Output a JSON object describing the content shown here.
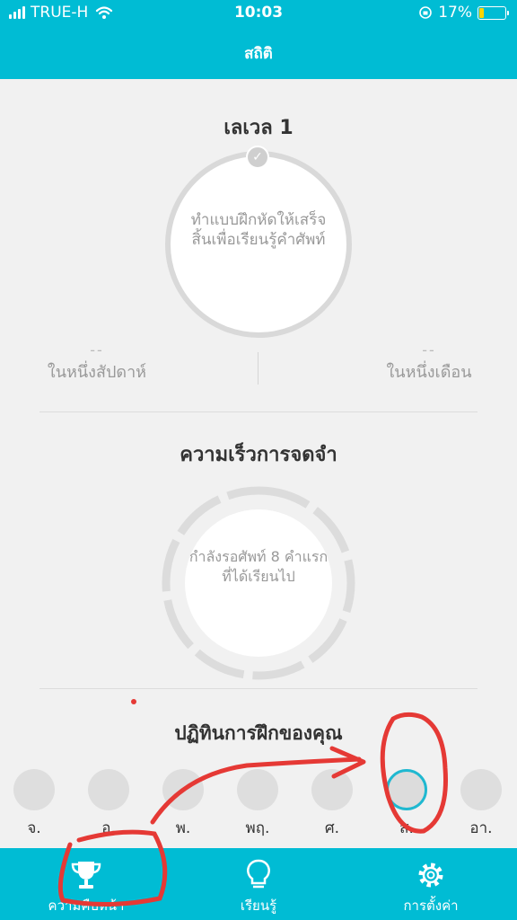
{
  "status_bar": {
    "carrier": "TRUE-H",
    "time": "10:03",
    "battery": "17%"
  },
  "header": {
    "title": "สถิติ"
  },
  "level": {
    "title": "เลเวล 1",
    "message": "ทำแบบฝึกหัดให้เสร็จสิ้นเพื่อเรียนรู้คำศัพท์",
    "weekly_value": "--",
    "weekly_label": "ในหนึ่งสัปดาห์",
    "monthly_value": "--",
    "monthly_label": "ในหนึ่งเดือน"
  },
  "memory_speed": {
    "title": "ความเร็วการจดจำ",
    "message": "กำลังรอศัพท์ 8 คำแรกที่ได้เรียนไป"
  },
  "calendar": {
    "title": "ปฏิทินการฝึกของคุณ",
    "days": [
      "จ.",
      "อ.",
      "พ.",
      "พฤ.",
      "ศ.",
      "ส.",
      "อา."
    ],
    "active_index": 5
  },
  "tab_bar": {
    "tabs": [
      {
        "label": "ความคืบหน้า",
        "icon": "trophy-icon",
        "active": true
      },
      {
        "label": "เรียนรู้",
        "icon": "lightbulb-icon",
        "active": false
      },
      {
        "label": "การตั้งค่า",
        "icon": "gear-icon",
        "active": false
      }
    ]
  },
  "colors": {
    "accent": "#00bcd4",
    "annotation": "#e53935"
  }
}
